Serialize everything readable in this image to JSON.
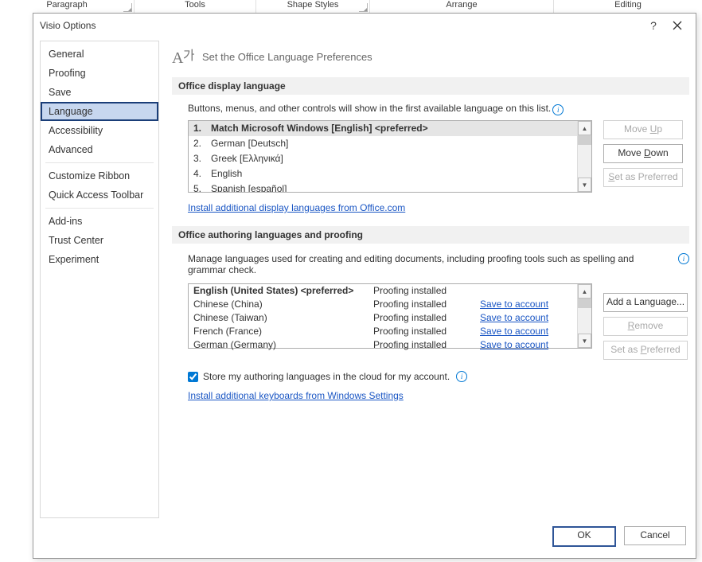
{
  "ribbon": {
    "groups": [
      "Paragraph",
      "Tools",
      "Shape Styles",
      "Arrange",
      "Editing"
    ]
  },
  "dialog": {
    "title": "Visio Options",
    "nav": {
      "general": "General",
      "proofing": "Proofing",
      "save": "Save",
      "language": "Language",
      "accessibility": "Accessibility",
      "advanced": "Advanced",
      "customize_ribbon": "Customize Ribbon",
      "qat": "Quick Access Toolbar",
      "addins": "Add-ins",
      "trust_center": "Trust Center",
      "experiment": "Experiment"
    },
    "page_heading": "Set the Office Language Preferences",
    "display": {
      "header": "Office display language",
      "desc": "Buttons, menus, and other controls will show in the first available language on this list.",
      "items": [
        "Match Microsoft Windows [English] <preferred>",
        "German [Deutsch]",
        "Greek [Ελληνικά]",
        "English",
        "Spanish [español]"
      ],
      "move_up": "Move Up",
      "move_down": "Move Down",
      "set_pref": "Set as Preferred",
      "link": "Install additional display languages from Office.com"
    },
    "authoring": {
      "header": "Office authoring languages and proofing",
      "desc": "Manage languages used for creating and editing documents, including proofing tools such as spelling and grammar check.",
      "rows": [
        {
          "lang": "English (United States) <preferred>",
          "status": "Proofing installed",
          "link": ""
        },
        {
          "lang": "Chinese (China)",
          "status": "Proofing installed",
          "link": "Save to account"
        },
        {
          "lang": "Chinese (Taiwan)",
          "status": "Proofing installed",
          "link": "Save to account"
        },
        {
          "lang": "French (France)",
          "status": "Proofing installed",
          "link": "Save to account"
        },
        {
          "lang": "German (Germany)",
          "status": "Proofing installed",
          "link": "Save to account"
        }
      ],
      "add": "Add a Language...",
      "remove": "Remove",
      "set_pref": "Set as Preferred",
      "checkbox": "Store my authoring languages in the cloud for my account.",
      "link": "Install additional keyboards from Windows Settings"
    },
    "buttons": {
      "ok": "OK",
      "cancel": "Cancel"
    }
  }
}
